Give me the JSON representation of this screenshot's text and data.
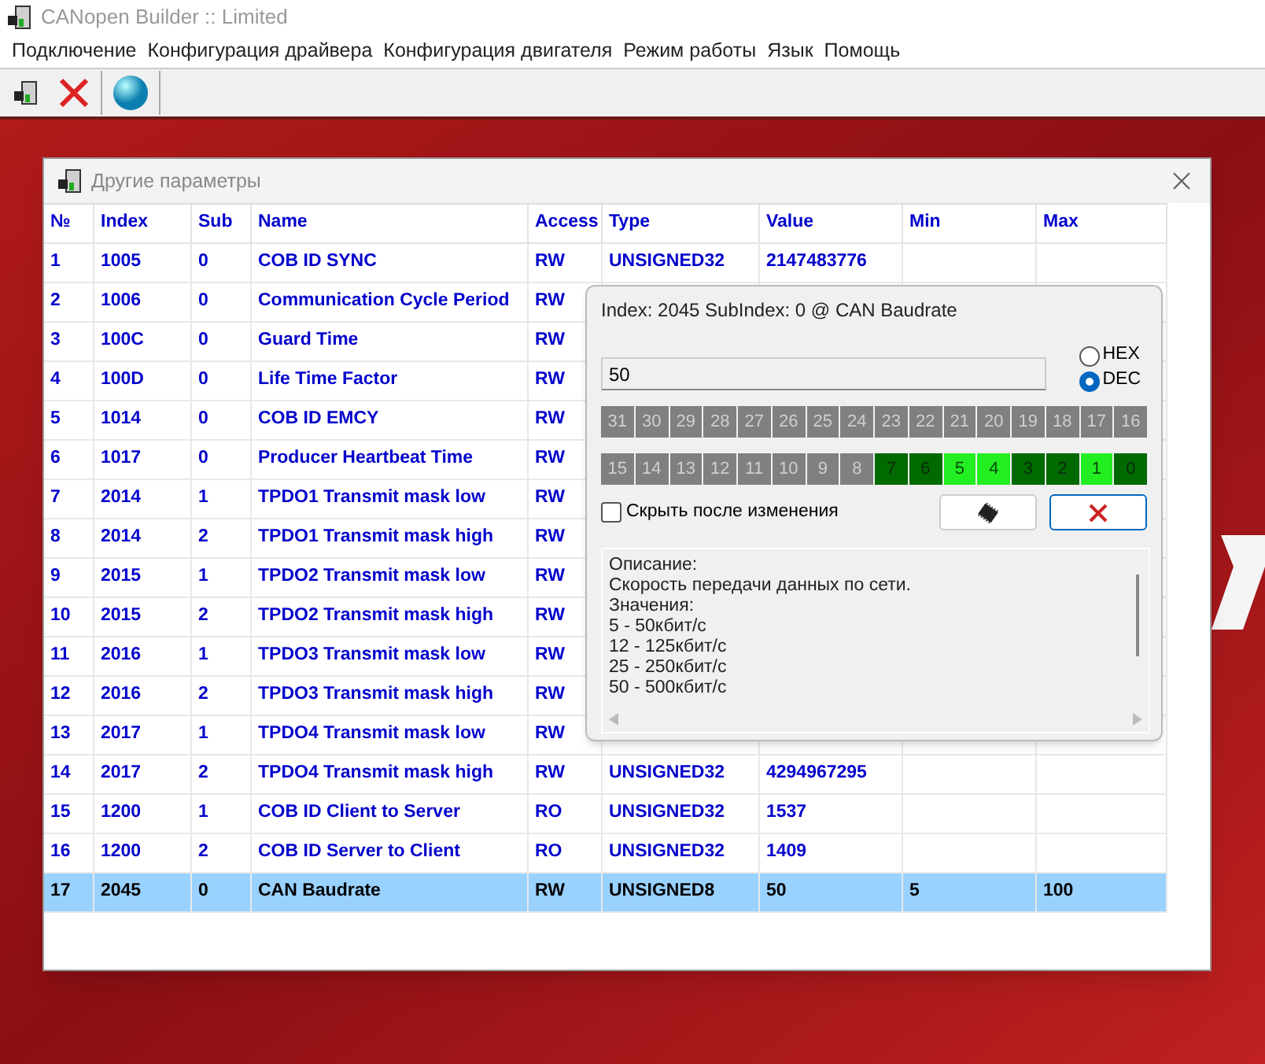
{
  "window": {
    "title": "CANopen Builder :: Limited"
  },
  "menu": [
    "Подключение",
    "Конфигурация драйвера",
    "Конфигурация двигателя",
    "Режим работы",
    "Язык",
    "Помощь"
  ],
  "dialog": {
    "title": "Другие параметры",
    "table": {
      "columns": [
        "№",
        "Index",
        "Sub",
        "Name",
        "Access",
        "Type",
        "Value",
        "Min",
        "Max"
      ],
      "rows": [
        {
          "cells": [
            "1",
            "1005",
            "0",
            "COB ID SYNC",
            "RW",
            "UNSIGNED32",
            "2147483776",
            "",
            ""
          ],
          "selected": false
        },
        {
          "cells": [
            "2",
            "1006",
            "0",
            "Communication Cycle Period",
            "RW"
          ],
          "selected": false
        },
        {
          "cells": [
            "3",
            "100C",
            "0",
            "Guard Time",
            "RW"
          ],
          "selected": false
        },
        {
          "cells": [
            "4",
            "100D",
            "0",
            "Life Time Factor",
            "RW"
          ],
          "selected": false
        },
        {
          "cells": [
            "5",
            "1014",
            "0",
            "COB ID EMCY",
            "RW"
          ],
          "selected": false
        },
        {
          "cells": [
            "6",
            "1017",
            "0",
            "Producer Heartbeat Time",
            "RW"
          ],
          "selected": false
        },
        {
          "cells": [
            "7",
            "2014",
            "1",
            "TPDO1 Transmit mask low",
            "RW"
          ],
          "selected": false
        },
        {
          "cells": [
            "8",
            "2014",
            "2",
            "TPDO1 Transmit mask high",
            "RW"
          ],
          "selected": false
        },
        {
          "cells": [
            "9",
            "2015",
            "1",
            "TPDO2 Transmit mask low",
            "RW"
          ],
          "selected": false
        },
        {
          "cells": [
            "10",
            "2015",
            "2",
            "TPDO2 Transmit mask high",
            "RW"
          ],
          "selected": false
        },
        {
          "cells": [
            "11",
            "2016",
            "1",
            "TPDO3 Transmit mask low",
            "RW"
          ],
          "selected": false
        },
        {
          "cells": [
            "12",
            "2016",
            "2",
            "TPDO3 Transmit mask high",
            "RW"
          ],
          "selected": false
        },
        {
          "cells": [
            "13",
            "2017",
            "1",
            "TPDO4 Transmit mask low",
            "RW"
          ],
          "selected": false
        },
        {
          "cells": [
            "14",
            "2017",
            "2",
            "TPDO4 Transmit mask high",
            "RW",
            "UNSIGNED32",
            "4294967295",
            "",
            ""
          ],
          "selected": false
        },
        {
          "cells": [
            "15",
            "1200",
            "1",
            "COB ID Client to Server",
            "RO",
            "UNSIGNED32",
            "1537",
            "",
            ""
          ],
          "selected": false
        },
        {
          "cells": [
            "16",
            "1200",
            "2",
            "COB ID Server to Client",
            "RO",
            "UNSIGNED32",
            "1409",
            "",
            ""
          ],
          "selected": false
        },
        {
          "cells": [
            "17",
            "2045",
            "0",
            "CAN Baudrate",
            "RW",
            "UNSIGNED8",
            "50",
            "5",
            "100"
          ],
          "selected": true
        }
      ]
    }
  },
  "editor": {
    "title": "Index: 2045 SubIndex: 0 @ CAN Baudrate",
    "value": "50",
    "radios": [
      {
        "label": "HEX",
        "selected": false
      },
      {
        "label": "DEC",
        "selected": true
      }
    ],
    "bits": [
      {
        "label": "31",
        "enabled": false,
        "on": false
      },
      {
        "label": "30",
        "enabled": false,
        "on": false
      },
      {
        "label": "29",
        "enabled": false,
        "on": false
      },
      {
        "label": "28",
        "enabled": false,
        "on": false
      },
      {
        "label": "27",
        "enabled": false,
        "on": false
      },
      {
        "label": "26",
        "enabled": false,
        "on": false
      },
      {
        "label": "25",
        "enabled": false,
        "on": false
      },
      {
        "label": "24",
        "enabled": false,
        "on": false
      },
      {
        "label": "23",
        "enabled": false,
        "on": false
      },
      {
        "label": "22",
        "enabled": false,
        "on": false
      },
      {
        "label": "21",
        "enabled": false,
        "on": false
      },
      {
        "label": "20",
        "enabled": false,
        "on": false
      },
      {
        "label": "19",
        "enabled": false,
        "on": false
      },
      {
        "label": "18",
        "enabled": false,
        "on": false
      },
      {
        "label": "17",
        "enabled": false,
        "on": false
      },
      {
        "label": "16",
        "enabled": false,
        "on": false
      },
      {
        "label": "15",
        "enabled": false,
        "on": false
      },
      {
        "label": "14",
        "enabled": false,
        "on": false
      },
      {
        "label": "13",
        "enabled": false,
        "on": false
      },
      {
        "label": "12",
        "enabled": false,
        "on": false
      },
      {
        "label": "11",
        "enabled": false,
        "on": false
      },
      {
        "label": "10",
        "enabled": false,
        "on": false
      },
      {
        "label": "9",
        "enabled": false,
        "on": false
      },
      {
        "label": "8",
        "enabled": false,
        "on": false
      },
      {
        "label": "7",
        "enabled": true,
        "on": false
      },
      {
        "label": "6",
        "enabled": true,
        "on": false
      },
      {
        "label": "5",
        "enabled": true,
        "on": true
      },
      {
        "label": "4",
        "enabled": true,
        "on": true
      },
      {
        "label": "3",
        "enabled": true,
        "on": false
      },
      {
        "label": "2",
        "enabled": true,
        "on": false
      },
      {
        "label": "1",
        "enabled": true,
        "on": true
      },
      {
        "label": "0",
        "enabled": true,
        "on": false
      }
    ],
    "hide_after_change": {
      "label": "Скрыть после изменения",
      "checked": false
    },
    "description": [
      "Описание:",
      "Скорость передачи данных по сети.",
      "Значения:",
      "5 - 50кбит/с",
      "12 - 125кбит/с",
      "25 - 250кбит/с",
      "50 - 500кбит/с"
    ]
  }
}
